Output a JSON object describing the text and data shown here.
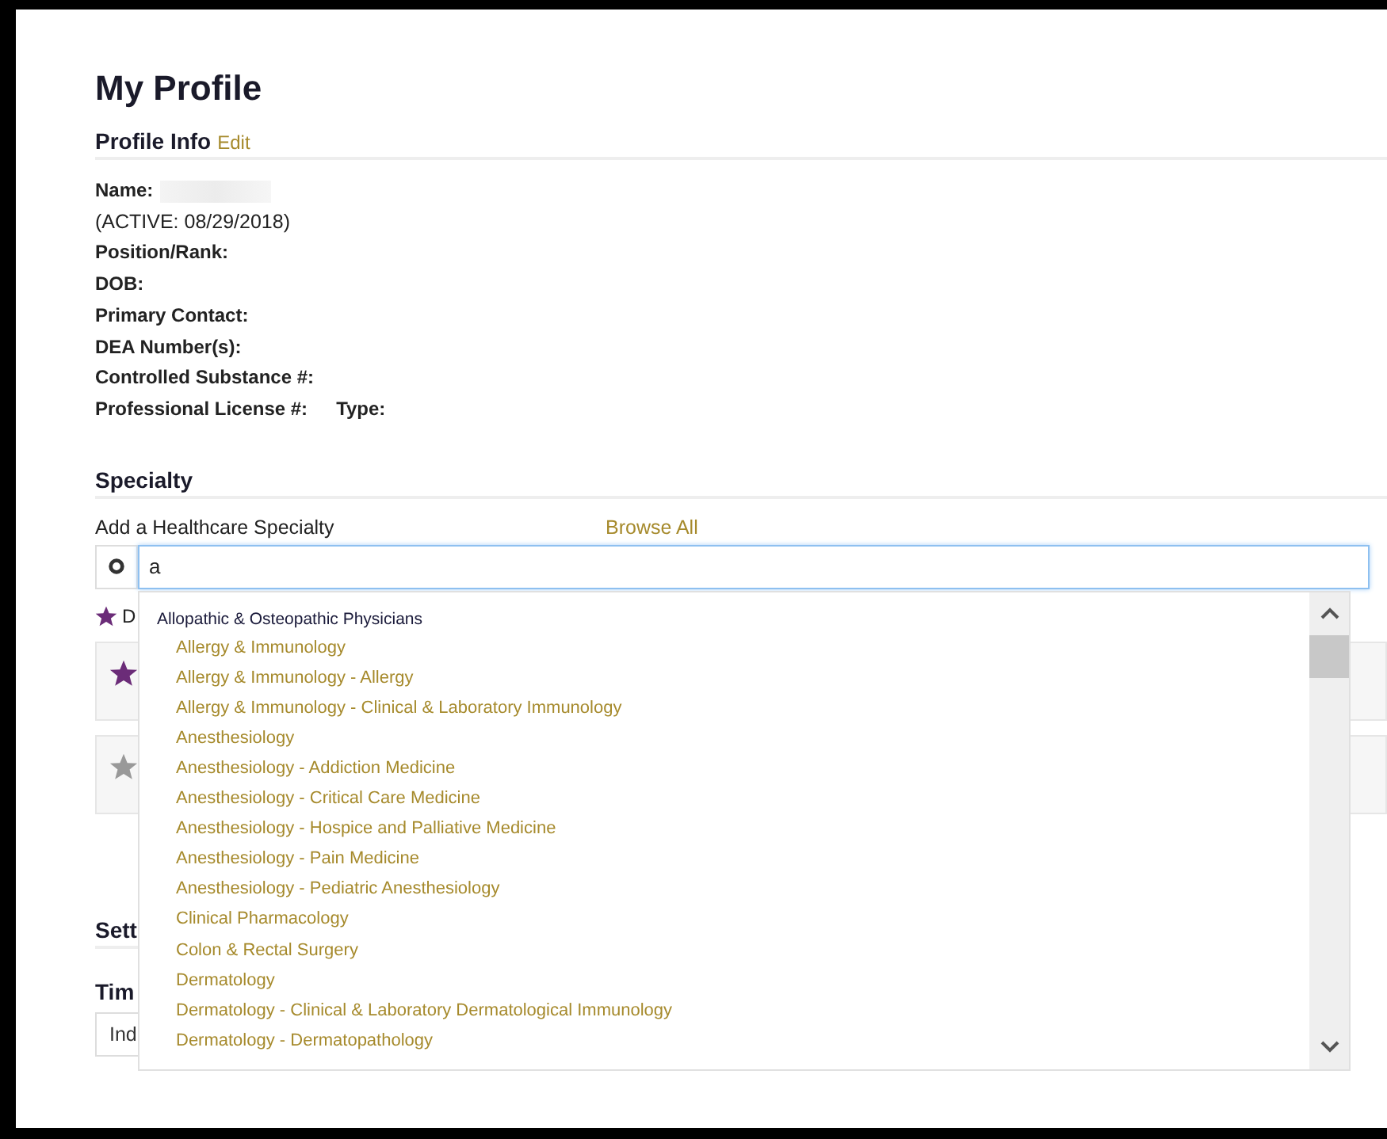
{
  "page": {
    "title": "My Profile"
  },
  "profile_info": {
    "heading": "Profile Info",
    "edit_link": "Edit",
    "lines": [
      {
        "kind": "field",
        "parts": [
          "Name:"
        ],
        "redacted": true
      },
      {
        "kind": "note",
        "parts": [
          "(ACTIVE: 08/29/2018)"
        ],
        "redacted": false
      },
      {
        "kind": "field",
        "parts": [
          "Position/Rank:"
        ],
        "redacted": false
      },
      {
        "kind": "field",
        "parts": [
          "DOB:"
        ],
        "redacted": false
      },
      {
        "kind": "field",
        "parts": [
          "Primary Contact:"
        ],
        "redacted": false
      },
      {
        "kind": "field",
        "parts": [
          "DEA Number(s):"
        ],
        "redacted": false
      },
      {
        "kind": "field",
        "parts": [
          "Controlled Substance #:"
        ],
        "redacted": false
      },
      {
        "kind": "field",
        "parts": [
          "Professional License #:",
          "Type:"
        ],
        "redacted": false
      }
    ]
  },
  "specialty": {
    "heading": "Specialty",
    "add_label": "Add a Healthcare Specialty",
    "browse_link": "Browse All",
    "search": {
      "value": "a"
    },
    "favorite_hint": {
      "text": "D"
    },
    "cards": [
      {
        "starred": true
      },
      {
        "starred": false
      }
    ],
    "dropdown": {
      "groups": [
        {
          "name": "Allopathic & Osteopathic Physicians",
          "items": [
            "Allergy & Immunology",
            "Allergy & Immunology - Allergy",
            "Allergy & Immunology - Clinical & Laboratory Immunology",
            "Anesthesiology",
            "Anesthesiology - Addiction Medicine",
            "Anesthesiology - Critical Care Medicine",
            "Anesthesiology - Hospice and Palliative Medicine",
            "Anesthesiology - Pain Medicine",
            "Anesthesiology - Pediatric Anesthesiology",
            "Clinical Pharmacology",
            "Colon & Rectal Surgery",
            "Dermatology",
            "Dermatology - Clinical & Laboratory Dermatological Immunology",
            "Dermatology - Dermatopathology"
          ]
        }
      ]
    }
  },
  "settings": {
    "heading": "Sett",
    "time_label": "Tim",
    "time_select": {
      "value": "Ind"
    }
  }
}
